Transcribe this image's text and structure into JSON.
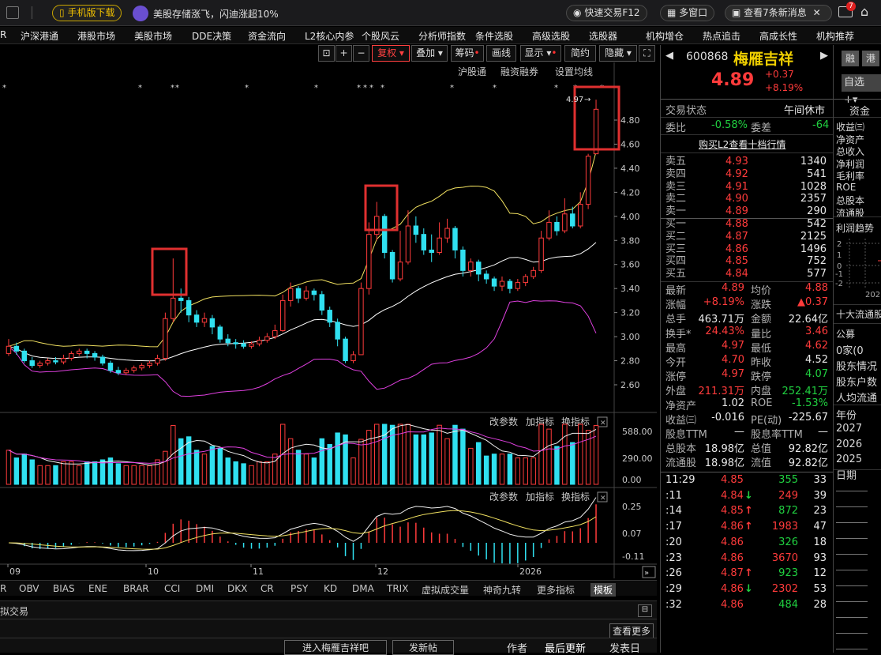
{
  "topbar": {
    "mobile_download": "手机版下载",
    "news_banner": "美股存储涨飞，闪迪涨超10%",
    "quick_trade": "快速交易F12",
    "multi_window": "多窗口",
    "messages": "查看7条新消息",
    "badge": "7"
  },
  "menu": [
    "R",
    "沪深港通",
    "港股市场",
    "美股市场",
    "DDE决策",
    "资金流向",
    "L2核心内参",
    "个股风云",
    "分析师指数",
    "条件选股",
    "高级选股",
    "选股器",
    "机构增仓",
    "热点追击",
    "高成长性",
    "机构推荐"
  ],
  "toolbar": {
    "fuquan": "复权",
    "overlay": "叠加",
    "chips": "筹码",
    "draw": "画线",
    "display": "显示",
    "simple": "简约",
    "hide": "隐藏"
  },
  "chart_links": {
    "hsgt": "沪股通",
    "margin": "融资融券",
    "settings": "设置均线"
  },
  "price_axis": [
    "4.80",
    "4.60",
    "4.40",
    "4.20",
    "4.00",
    "3.80",
    "3.60",
    "3.40",
    "3.20",
    "3.00",
    "2.80",
    "2.60"
  ],
  "high_marker": "4.97",
  "vol_panel": {
    "change_param": "改参数",
    "add_ind": "加指标",
    "switch_ind": "换指标",
    "axis": [
      "588.00",
      "290.00",
      "0.00"
    ]
  },
  "macd_panel": {
    "change_param": "改参数",
    "add_ind": "加指标",
    "switch_ind": "换指标",
    "axis": [
      "0.25",
      "0.07",
      "-0.11"
    ]
  },
  "time_axis": [
    "09",
    "10",
    "11",
    "12",
    "2026"
  ],
  "indicators": [
    "R",
    "OBV",
    "BIAS",
    "ENE",
    "BRAR",
    "CCI",
    "DMI",
    "DKX",
    "CR",
    "PSY",
    "KD",
    "DMA",
    "TRIX",
    "虚拟成交量",
    "神奇九转",
    "更多指标",
    "模板"
  ],
  "bottom": {
    "virtual_trade": "拟交易",
    "enter_bar": "进入梅雁吉祥吧",
    "post": "发新帖",
    "view_more": "查看更多",
    "author": "作者",
    "last_update": "最后更新",
    "post_time": "发表日"
  },
  "stock": {
    "code": "600868",
    "name": "梅雁吉祥",
    "price": "4.89",
    "change": "+0.37",
    "pct": "+8.19%",
    "margin_tag": "融",
    "hk_tag": "港",
    "watchlist": "自选"
  },
  "status": {
    "label": "交易状态",
    "value": "午间休市"
  },
  "wei": {
    "ratio_label": "委比",
    "ratio": "-0.58%",
    "diff_label": "委差",
    "diff": "-64"
  },
  "l2_link": "购买L2查看十档行情",
  "asks": [
    {
      "l": "卖五",
      "p": "4.93",
      "v": "1340"
    },
    {
      "l": "卖四",
      "p": "4.92",
      "v": "541"
    },
    {
      "l": "卖三",
      "p": "4.91",
      "v": "1028"
    },
    {
      "l": "卖二",
      "p": "4.90",
      "v": "2357"
    },
    {
      "l": "卖一",
      "p": "4.89",
      "v": "290"
    }
  ],
  "bids": [
    {
      "l": "买一",
      "p": "4.88",
      "v": "542"
    },
    {
      "l": "买二",
      "p": "4.87",
      "v": "2125"
    },
    {
      "l": "买三",
      "p": "4.86",
      "v": "1496"
    },
    {
      "l": "买四",
      "p": "4.85",
      "v": "752"
    },
    {
      "l": "买五",
      "p": "4.84",
      "v": "577"
    }
  ],
  "stats": [
    {
      "l1": "最新",
      "v1": "4.89",
      "l2": "均价",
      "v2": "4.88"
    },
    {
      "l1": "涨幅",
      "v1": "+8.19%",
      "l2": "涨跌",
      "v2": "▲0.37"
    },
    {
      "l1": "总手",
      "v1": "463.71万",
      "l2": "金额",
      "v2": "22.64亿"
    },
    {
      "l1": "换手*",
      "v1": "24.43%",
      "l2": "量比",
      "v2": "3.46"
    },
    {
      "l1": "最高",
      "v1": "4.97",
      "l2": "最低",
      "v2": "4.62"
    },
    {
      "l1": "今开",
      "v1": "4.70",
      "l2": "昨收",
      "v2": "4.52"
    },
    {
      "l1": "涨停",
      "v1": "4.97",
      "l2": "跌停",
      "v2": "4.07"
    },
    {
      "l1": "外盘",
      "v1": "211.31万",
      "l2": "内盘",
      "v2": "252.41万"
    },
    {
      "l1": "净资产",
      "v1": "1.02",
      "l2": "ROE",
      "v2": "-1.53%"
    },
    {
      "l1": "收益㈢",
      "v1": "-0.016",
      "l2": "PE(动)",
      "v2": "-225.67"
    },
    {
      "l1": "股息TTM",
      "v1": "—",
      "l2": "股息率TTM",
      "v2": "—"
    },
    {
      "l1": "总股本",
      "v1": "18.98亿",
      "l2": "总值",
      "v2": "92.82亿"
    },
    {
      "l1": "流通股",
      "v1": "18.98亿",
      "l2": "流值",
      "v2": "92.82亿"
    }
  ],
  "ticks": [
    {
      "t": "11:29",
      "p": "4.85",
      "a": "",
      "v": "355",
      "n": "33"
    },
    {
      "t": ":11",
      "p": "4.84",
      "a": "↓",
      "v": "249",
      "n": "39"
    },
    {
      "t": ":14",
      "p": "4.85",
      "a": "↑",
      "v": "872",
      "n": "23"
    },
    {
      "t": ":17",
      "p": "4.86",
      "a": "↑",
      "v": "1983",
      "n": "47"
    },
    {
      "t": ":20",
      "p": "4.86",
      "a": "",
      "v": "326",
      "n": "18"
    },
    {
      "t": ":23",
      "p": "4.86",
      "a": "",
      "v": "3670",
      "n": "93"
    },
    {
      "t": ":26",
      "p": "4.87",
      "a": "↑",
      "v": "923",
      "n": "12"
    },
    {
      "t": ":29",
      "p": "4.86",
      "a": "↓",
      "v": "2302",
      "n": "53"
    },
    {
      "t": ":32",
      "p": "4.86",
      "a": "",
      "v": "484",
      "n": "28"
    }
  ],
  "far": {
    "tab": "资金",
    "lines": [
      "收益㈢",
      "净资产",
      "总收入",
      "净利润",
      "毛利率",
      "ROE",
      "总股本",
      "流通股"
    ],
    "profit": "利润趋势",
    "holders": "十大流通股",
    "pub": "公募",
    "zero": "0家(0",
    "holder_info": "股东情况",
    "holder_count": "股东户数",
    "per_capita": "人均流通",
    "year": "年份",
    "years": [
      "2027",
      "2026",
      "2025"
    ],
    "date": "日期"
  },
  "chart_data": {
    "type": "candlestick",
    "ylim": [
      2.5,
      5.0
    ],
    "x_labels": [
      "09",
      "10",
      "11",
      "12",
      "2026"
    ],
    "candles": [
      [
        2.86,
        2.92,
        2.98,
        2.84
      ],
      [
        2.92,
        2.88,
        2.95,
        2.85
      ],
      [
        2.88,
        2.8,
        2.9,
        2.78
      ],
      [
        2.8,
        2.76,
        2.83,
        2.74
      ],
      [
        2.76,
        2.78,
        2.8,
        2.74
      ],
      [
        2.78,
        2.8,
        2.82,
        2.76
      ],
      [
        2.8,
        2.79,
        2.83,
        2.77
      ],
      [
        2.79,
        2.82,
        2.85,
        2.77
      ],
      [
        2.82,
        2.86,
        2.88,
        2.8
      ],
      [
        2.86,
        2.88,
        2.9,
        2.84
      ],
      [
        2.88,
        2.86,
        2.9,
        2.82
      ],
      [
        2.86,
        2.83,
        2.88,
        2.8
      ],
      [
        2.83,
        2.78,
        2.85,
        2.76
      ],
      [
        2.78,
        2.72,
        2.8,
        2.7
      ],
      [
        2.72,
        2.7,
        2.75,
        2.68
      ],
      [
        2.7,
        2.72,
        2.74,
        2.68
      ],
      [
        2.72,
        2.74,
        2.76,
        2.7
      ],
      [
        2.74,
        2.76,
        2.78,
        2.72
      ],
      [
        2.76,
        2.78,
        2.8,
        2.74
      ],
      [
        2.78,
        2.82,
        2.85,
        2.76
      ],
      [
        2.82,
        3.15,
        3.2,
        2.8
      ],
      [
        3.15,
        3.32,
        3.65,
        3.12
      ],
      [
        3.32,
        3.3,
        3.4,
        3.2
      ],
      [
        3.3,
        3.18,
        3.33,
        3.12
      ],
      [
        3.18,
        3.12,
        3.22,
        3.08
      ],
      [
        3.12,
        3.15,
        3.2,
        3.08
      ],
      [
        3.15,
        3.08,
        3.18,
        3.02
      ],
      [
        3.08,
        2.98,
        3.1,
        2.95
      ],
      [
        2.98,
        2.95,
        3.02,
        2.92
      ],
      [
        2.95,
        2.94,
        2.98,
        2.9
      ],
      [
        2.94,
        2.92,
        2.97,
        2.9
      ],
      [
        2.92,
        2.94,
        2.96,
        2.9
      ],
      [
        2.94,
        2.97,
        3.0,
        2.92
      ],
      [
        2.97,
        3.0,
        3.03,
        2.95
      ],
      [
        3.0,
        3.05,
        3.1,
        2.98
      ],
      [
        3.05,
        3.3,
        3.35,
        3.04
      ],
      [
        3.3,
        3.4,
        3.45,
        3.25
      ],
      [
        3.4,
        3.32,
        3.42,
        3.28
      ],
      [
        3.32,
        3.38,
        3.42,
        3.3
      ],
      [
        3.38,
        3.35,
        3.4,
        3.3
      ],
      [
        3.35,
        3.22,
        3.38,
        3.18
      ],
      [
        3.22,
        3.12,
        3.25,
        3.08
      ],
      [
        3.12,
        2.98,
        3.15,
        2.92
      ],
      [
        2.98,
        2.8,
        3.0,
        2.78
      ],
      [
        2.8,
        2.85,
        2.88,
        2.78
      ],
      [
        2.85,
        3.4,
        3.45,
        3.08
      ],
      [
        3.4,
        3.85,
        3.95,
        3.35
      ],
      [
        3.85,
        4.0,
        4.12,
        3.8
      ],
      [
        4.0,
        3.7,
        4.02,
        3.65
      ],
      [
        3.7,
        3.48,
        3.72,
        3.45
      ],
      [
        3.48,
        3.62,
        3.88,
        3.46
      ],
      [
        3.62,
        3.92,
        4.05,
        3.6
      ],
      [
        3.92,
        3.85,
        4.0,
        3.78
      ],
      [
        3.85,
        3.72,
        3.9,
        3.68
      ],
      [
        3.72,
        3.7,
        3.85,
        3.62
      ],
      [
        3.7,
        3.82,
        3.95,
        3.68
      ],
      [
        3.82,
        3.9,
        3.98,
        3.78
      ],
      [
        3.9,
        3.72,
        3.92,
        3.65
      ],
      [
        3.72,
        3.55,
        3.75,
        3.5
      ],
      [
        3.55,
        3.62,
        3.65,
        3.5
      ],
      [
        3.62,
        3.52,
        3.64,
        3.46
      ],
      [
        3.52,
        3.48,
        3.55,
        3.44
      ],
      [
        3.48,
        3.42,
        3.5,
        3.38
      ],
      [
        3.42,
        3.46,
        3.5,
        3.38
      ],
      [
        3.46,
        3.4,
        3.48,
        3.36
      ],
      [
        3.4,
        3.45,
        3.48,
        3.38
      ],
      [
        3.45,
        3.5,
        3.52,
        3.42
      ],
      [
        3.5,
        3.55,
        3.58,
        3.48
      ],
      [
        3.55,
        3.82,
        3.88,
        3.53
      ],
      [
        3.82,
        3.95,
        4.05,
        3.8
      ],
      [
        3.95,
        3.88,
        4.0,
        3.84
      ],
      [
        3.88,
        4.02,
        4.15,
        3.86
      ],
      [
        4.02,
        3.92,
        4.08,
        3.9
      ],
      [
        3.92,
        4.1,
        4.2,
        3.9
      ],
      [
        4.1,
        4.5,
        4.52,
        4.06
      ],
      [
        4.52,
        4.89,
        4.97,
        4.62
      ]
    ],
    "volume_max": 588,
    "macd_range": [
      -0.11,
      0.25
    ]
  }
}
